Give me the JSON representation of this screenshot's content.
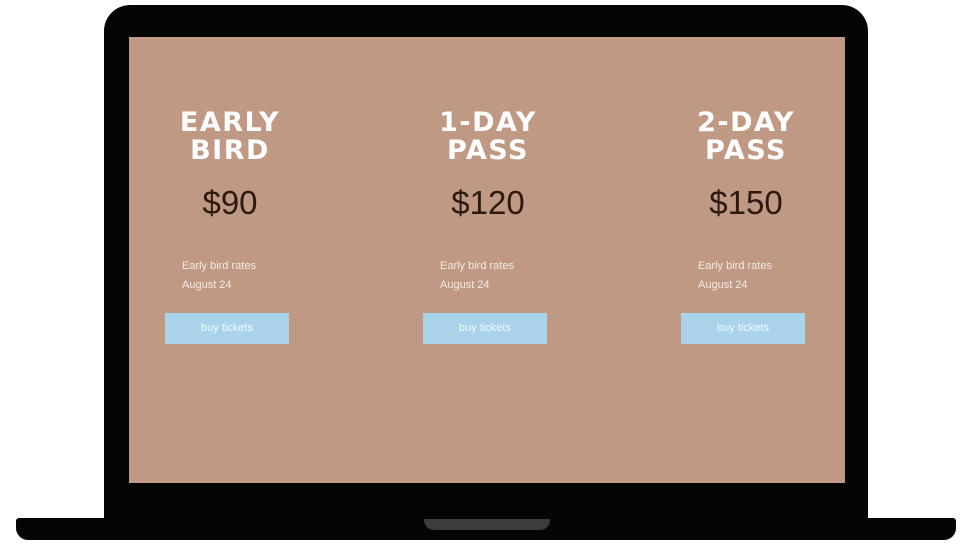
{
  "pricing": {
    "plans": [
      {
        "title_line1": "EARLY",
        "title_line2": "BIRD",
        "price": "$90",
        "desc_line1": "Early bird rates",
        "desc_line2": "August 24",
        "button_label": "buy tickets"
      },
      {
        "title_line1": "1-DAY",
        "title_line2": "PASS",
        "price": "$120",
        "desc_line1": "Early bird rates",
        "desc_line2": "August 24",
        "button_label": "buy tickets"
      },
      {
        "title_line1": "2-DAY",
        "title_line2": "PASS",
        "price": "$150",
        "desc_line1": "Early bird rates",
        "desc_line2": "August 24",
        "button_label": "buy tickets"
      }
    ]
  },
  "colors": {
    "screen_background": "#bf9984",
    "button_background": "#a9d3e9",
    "title_text": "#ffffff",
    "price_text": "#2a1a12",
    "laptop_frame": "#050505"
  }
}
